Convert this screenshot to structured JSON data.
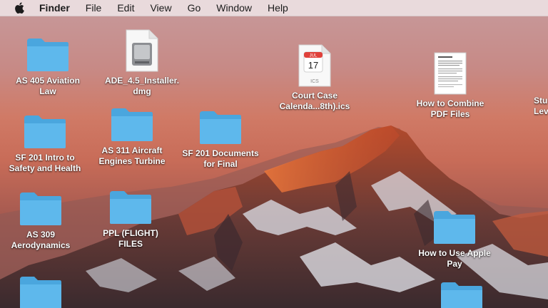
{
  "menubar": {
    "app_name": "Finder",
    "menus": [
      "File",
      "Edit",
      "View",
      "Go",
      "Window",
      "Help"
    ]
  },
  "icons": [
    {
      "type": "folder",
      "line1": "AS 405 Aviation",
      "line2": "Law"
    },
    {
      "type": "disk-image",
      "line1": "ADE_4.5_Installer.",
      "line2": "dmg"
    },
    {
      "type": "ics-file",
      "line1": "Court Case",
      "line2": "Calenda...8th).ics",
      "badge_month": "JUL",
      "badge_day": "17",
      "ext": "ICS"
    },
    {
      "type": "document",
      "line1": "How to Combine",
      "line2": "PDF Files"
    },
    {
      "type": "folder",
      "line1": "Stu",
      "line2": "Lev"
    },
    {
      "type": "folder",
      "line1": "SF 201 Intro to",
      "line2": "Safety and Health"
    },
    {
      "type": "folder",
      "line1": "AS 311 Aircraft",
      "line2": "Engines Turbine"
    },
    {
      "type": "folder",
      "line1": "SF 201 Documents",
      "line2": "for Final"
    },
    {
      "type": "folder",
      "line1": "AS 309",
      "line2": "Aerodynamics"
    },
    {
      "type": "folder",
      "line1": "PPL (FLIGHT)",
      "line2": "FILES"
    },
    {
      "type": "folder",
      "line1": "How to Use Apple",
      "line2": "Pay"
    },
    {
      "type": "folder",
      "line1": "",
      "line2": ""
    },
    {
      "type": "folder",
      "line1": "",
      "line2": ""
    }
  ],
  "colors": {
    "folder_front": "#5eb8ec",
    "folder_back": "#4aa6de",
    "label_text": "#ffffff"
  }
}
